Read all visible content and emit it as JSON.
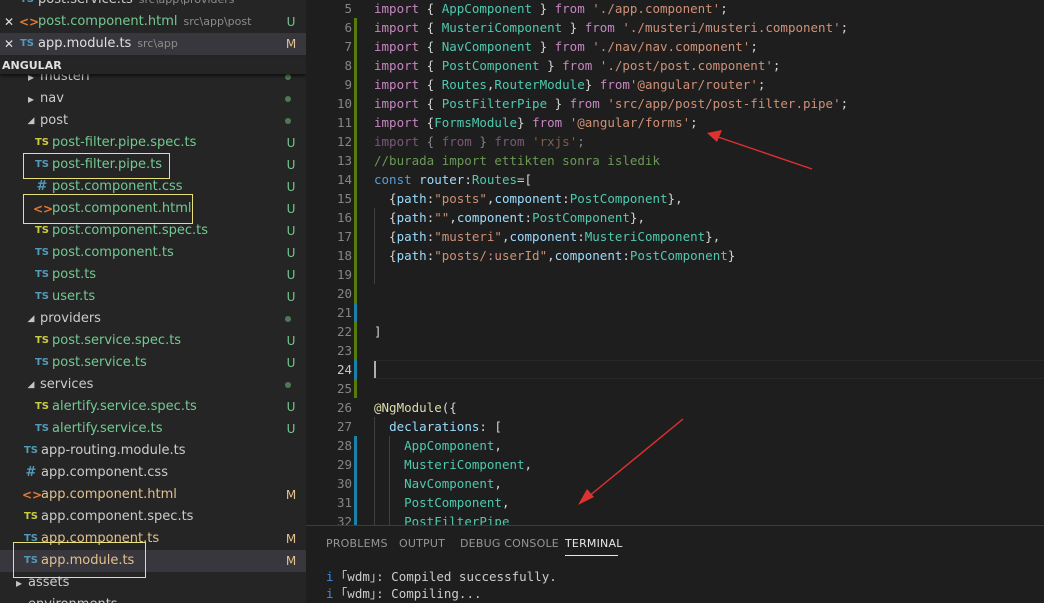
{
  "sidebar": {
    "open_editors": [
      {
        "icon": "ts-file-icon",
        "name": "post.service.ts",
        "path": "src\\app\\providers",
        "status": "",
        "close": false
      },
      {
        "icon": "html-file-icon",
        "name": "post.component.html",
        "path": "src\\app\\post",
        "status": "U",
        "close": true
      },
      {
        "icon": "ts-file-icon",
        "name": "app.module.ts",
        "path": "src\\app",
        "status": "M",
        "close": true,
        "active": true
      }
    ],
    "section_title": "ANGULAR",
    "tree": [
      {
        "kind": "folder",
        "name": "musteri",
        "depth": 1,
        "open": false,
        "status": "dot"
      },
      {
        "kind": "folder",
        "name": "nav",
        "depth": 1,
        "open": false,
        "status": "dot"
      },
      {
        "kind": "folder",
        "name": "post",
        "depth": 1,
        "open": true,
        "status": "dot"
      },
      {
        "kind": "spec",
        "name": "post-filter.pipe.spec.ts",
        "depth": 2,
        "status": "U"
      },
      {
        "kind": "ts",
        "name": "post-filter.pipe.ts",
        "depth": 2,
        "status": "U",
        "highlight": true
      },
      {
        "kind": "css",
        "name": "post.component.css",
        "depth": 2,
        "status": "U"
      },
      {
        "kind": "html",
        "name": "post.component.html",
        "depth": 2,
        "status": "U",
        "highlight": true
      },
      {
        "kind": "spec",
        "name": "post.component.spec.ts",
        "depth": 2,
        "status": "U"
      },
      {
        "kind": "ts",
        "name": "post.component.ts",
        "depth": 2,
        "status": "U"
      },
      {
        "kind": "ts",
        "name": "post.ts",
        "depth": 2,
        "status": "U"
      },
      {
        "kind": "ts",
        "name": "user.ts",
        "depth": 2,
        "status": "U"
      },
      {
        "kind": "folder",
        "name": "providers",
        "depth": 1,
        "open": true,
        "status": "dot"
      },
      {
        "kind": "spec",
        "name": "post.service.spec.ts",
        "depth": 2,
        "status": "U"
      },
      {
        "kind": "ts",
        "name": "post.service.ts",
        "depth": 2,
        "status": "U"
      },
      {
        "kind": "folder",
        "name": "services",
        "depth": 1,
        "open": true,
        "status": "dot"
      },
      {
        "kind": "spec",
        "name": "alertify.service.spec.ts",
        "depth": 2,
        "status": "U"
      },
      {
        "kind": "ts",
        "name": "alertify.service.ts",
        "depth": 2,
        "status": "U"
      },
      {
        "kind": "ts",
        "name": "app-routing.module.ts",
        "depth": 0,
        "status": ""
      },
      {
        "kind": "css",
        "name": "app.component.css",
        "depth": 0,
        "status": ""
      },
      {
        "kind": "html",
        "name": "app.component.html",
        "depth": 0,
        "status": "M"
      },
      {
        "kind": "spec",
        "name": "app.component.spec.ts",
        "depth": 0,
        "status": ""
      },
      {
        "kind": "ts",
        "name": "app.component.ts",
        "depth": 0,
        "status": "M"
      },
      {
        "kind": "ts",
        "name": "app.module.ts",
        "depth": 0,
        "status": "M",
        "highlight": true,
        "selected": true
      },
      {
        "kind": "folder",
        "name": "assets",
        "depth": -1,
        "open": false,
        "status": ""
      },
      {
        "kind": "folder",
        "name": "environments",
        "depth": -1,
        "open": false,
        "status": ""
      }
    ]
  },
  "editor": {
    "cursor_line": 24,
    "lines": [
      {
        "n": 5,
        "g": "",
        "t": [
          [
            "k",
            "import"
          ],
          [
            "p",
            " { "
          ],
          [
            "c",
            "AppComponent"
          ],
          [
            "p",
            " } "
          ],
          [
            "k",
            "from"
          ],
          [
            "p",
            " "
          ],
          [
            "s",
            "'./app.component'"
          ],
          [
            "p",
            ";"
          ]
        ]
      },
      {
        "n": 6,
        "g": "added",
        "t": [
          [
            "k",
            "import"
          ],
          [
            "p",
            " { "
          ],
          [
            "c",
            "MusteriComponent"
          ],
          [
            "p",
            " } "
          ],
          [
            "k",
            "from"
          ],
          [
            "p",
            " "
          ],
          [
            "s",
            "'./musteri/musteri.component'"
          ],
          [
            "p",
            ";"
          ]
        ]
      },
      {
        "n": 7,
        "g": "added",
        "t": [
          [
            "k",
            "import"
          ],
          [
            "p",
            " { "
          ],
          [
            "c",
            "NavComponent"
          ],
          [
            "p",
            " } "
          ],
          [
            "k",
            "from"
          ],
          [
            "p",
            " "
          ],
          [
            "s",
            "'./nav/nav.component'"
          ],
          [
            "p",
            ";"
          ]
        ]
      },
      {
        "n": 8,
        "g": "added",
        "t": [
          [
            "k",
            "import"
          ],
          [
            "p",
            " { "
          ],
          [
            "c",
            "PostComponent"
          ],
          [
            "p",
            " } "
          ],
          [
            "k",
            "from"
          ],
          [
            "p",
            " "
          ],
          [
            "s",
            "'./post/post.component'"
          ],
          [
            "p",
            ";"
          ]
        ]
      },
      {
        "n": 9,
        "g": "added",
        "t": [
          [
            "k",
            "import"
          ],
          [
            "p",
            " { "
          ],
          [
            "c",
            "Routes"
          ],
          [
            "p",
            ","
          ],
          [
            "c",
            "RouterModule"
          ],
          [
            "p",
            "} "
          ],
          [
            "k",
            "from"
          ],
          [
            "s",
            "'@angular/router'"
          ],
          [
            "p",
            ";"
          ]
        ]
      },
      {
        "n": 10,
        "g": "added",
        "t": [
          [
            "k",
            "import"
          ],
          [
            "p",
            " { "
          ],
          [
            "c",
            "PostFilterPipe"
          ],
          [
            "p",
            " } "
          ],
          [
            "k",
            "from"
          ],
          [
            "p",
            " "
          ],
          [
            "s",
            "'src/app/post/post-filter.pipe'"
          ],
          [
            "p",
            ";"
          ]
        ]
      },
      {
        "n": 11,
        "g": "added",
        "t": [
          [
            "k",
            "import"
          ],
          [
            "p",
            " {"
          ],
          [
            "c",
            "FormsModule"
          ],
          [
            "p",
            "} "
          ],
          [
            "k",
            "from"
          ],
          [
            "p",
            " "
          ],
          [
            "s",
            "'@angular/forms'"
          ],
          [
            "p",
            ";"
          ]
        ]
      },
      {
        "n": 12,
        "g": "added",
        "dim": true,
        "t": [
          [
            "k",
            "import"
          ],
          [
            "p",
            " { "
          ],
          [
            "k",
            "from"
          ],
          [
            "p",
            " } "
          ],
          [
            "k",
            "from"
          ],
          [
            "p",
            " "
          ],
          [
            "s",
            "'rxjs'"
          ],
          [
            "p",
            ";"
          ]
        ]
      },
      {
        "n": 13,
        "g": "added",
        "t": [
          [
            "m",
            "//burada import ettikten sonra isledik"
          ]
        ]
      },
      {
        "n": 14,
        "g": "added",
        "t": [
          [
            "w",
            "const"
          ],
          [
            "p",
            " "
          ],
          [
            "i",
            "router"
          ],
          [
            "p",
            ":"
          ],
          [
            "c",
            "Routes"
          ],
          [
            "p",
            "=["
          ]
        ]
      },
      {
        "n": 15,
        "g": "added",
        "t": [
          [
            "p",
            "  {"
          ],
          [
            "i",
            "path"
          ],
          [
            "p",
            ":"
          ],
          [
            "s",
            "\"posts\""
          ],
          [
            "p",
            ","
          ],
          [
            "i",
            "component"
          ],
          [
            "p",
            ":"
          ],
          [
            "c",
            "PostComponent"
          ],
          [
            "p",
            "},"
          ]
        ]
      },
      {
        "n": 16,
        "g": "added",
        "t": [
          [
            "p",
            "  {"
          ],
          [
            "i",
            "path"
          ],
          [
            "p",
            ":"
          ],
          [
            "s",
            "\"\""
          ],
          [
            "p",
            ","
          ],
          [
            "i",
            "component"
          ],
          [
            "p",
            ":"
          ],
          [
            "c",
            "PostComponent"
          ],
          [
            "p",
            "},"
          ]
        ]
      },
      {
        "n": 17,
        "g": "added",
        "t": [
          [
            "p",
            "  {"
          ],
          [
            "i",
            "path"
          ],
          [
            "p",
            ":"
          ],
          [
            "s",
            "\"musteri\""
          ],
          [
            "p",
            ","
          ],
          [
            "i",
            "component"
          ],
          [
            "p",
            ":"
          ],
          [
            "c",
            "MusteriComponent"
          ],
          [
            "p",
            "},"
          ]
        ]
      },
      {
        "n": 18,
        "g": "added",
        "t": [
          [
            "p",
            "  {"
          ],
          [
            "i",
            "path"
          ],
          [
            "p",
            ":"
          ],
          [
            "s",
            "\"posts/:userId\""
          ],
          [
            "p",
            ","
          ],
          [
            "i",
            "component"
          ],
          [
            "p",
            ":"
          ],
          [
            "c",
            "PostComponent"
          ],
          [
            "p",
            "}"
          ]
        ]
      },
      {
        "n": 19,
        "g": "added",
        "t": []
      },
      {
        "n": 20,
        "g": "added",
        "t": []
      },
      {
        "n": 21,
        "g": "mod",
        "t": []
      },
      {
        "n": 22,
        "g": "added",
        "t": [
          [
            "p",
            "]"
          ]
        ]
      },
      {
        "n": 23,
        "g": "added",
        "t": []
      },
      {
        "n": 24,
        "g": "mod",
        "t": []
      },
      {
        "n": 25,
        "g": "added",
        "t": []
      },
      {
        "n": 26,
        "g": "",
        "t": [
          [
            "f",
            "@NgModule"
          ],
          [
            "p",
            "({"
          ]
        ]
      },
      {
        "n": 27,
        "g": "",
        "t": [
          [
            "p",
            "  "
          ],
          [
            "i",
            "declarations"
          ],
          [
            "p",
            ": ["
          ]
        ]
      },
      {
        "n": 28,
        "g": "mod",
        "t": [
          [
            "p",
            "    "
          ],
          [
            "c",
            "AppComponent"
          ],
          [
            "p",
            ","
          ]
        ]
      },
      {
        "n": 29,
        "g": "mod",
        "t": [
          [
            "p",
            "    "
          ],
          [
            "c",
            "MusteriComponent"
          ],
          [
            "p",
            ","
          ]
        ]
      },
      {
        "n": 30,
        "g": "mod",
        "t": [
          [
            "p",
            "    "
          ],
          [
            "c",
            "NavComponent"
          ],
          [
            "p",
            ","
          ]
        ]
      },
      {
        "n": 31,
        "g": "mod",
        "t": [
          [
            "p",
            "    "
          ],
          [
            "c",
            "PostComponent"
          ],
          [
            "p",
            ","
          ]
        ]
      },
      {
        "n": 32,
        "g": "mod",
        "t": [
          [
            "p",
            "    "
          ],
          [
            "c",
            "PostFilterPipe"
          ]
        ]
      }
    ]
  },
  "panel": {
    "tabs": [
      "PROBLEMS",
      "OUTPUT",
      "DEBUG CONSOLE",
      "TERMINAL"
    ],
    "active_tab": "TERMINAL",
    "terminal_lines": [
      {
        "prefix": "i",
        "text": " ｢wdm｣: Compiled successfully."
      },
      {
        "prefix": "i",
        "text": " ｢wdm｣: Compiling..."
      }
    ]
  },
  "colors": {
    "untracked": "#73c991",
    "modified": "#e2c08d",
    "highlight_box": "#e8e07a",
    "annotation_arrow": "#e03131"
  }
}
